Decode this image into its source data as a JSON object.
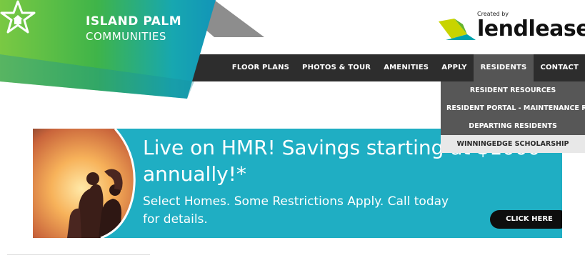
{
  "brand": {
    "name_line1": "ISLAND PALM",
    "name_line2": "COMMUNITIES",
    "colors": {
      "green": "#3fb449",
      "teal": "#1aa3b8",
      "grey": "#8d8d8d"
    }
  },
  "partner": {
    "created_by": "Created by",
    "name": "lendlease"
  },
  "nav": {
    "items": [
      {
        "label": "FLOOR PLANS"
      },
      {
        "label": "PHOTOS & TOUR"
      },
      {
        "label": "AMENITIES"
      },
      {
        "label": "APPLY"
      },
      {
        "label": "RESIDENTS",
        "active": true
      },
      {
        "label": "CONTACT"
      }
    ]
  },
  "residents_menu": {
    "items": [
      {
        "label": "RESIDENT RESOURCES"
      },
      {
        "label": "RESIDENT PORTAL - MAINTENANCE REQUE"
      },
      {
        "label": "DEPARTING RESIDENTS"
      },
      {
        "label": "WINNINGEDGE SCHOLARSHIP",
        "hovered": true
      }
    ]
  },
  "hero": {
    "title": "Live on HMR! Savings starting at $1000 annually!*",
    "subtitle": "Select Homes. Some Restrictions Apply. Call today for details.",
    "cta_label": "CLICK HERE",
    "background": "#1faec3"
  }
}
